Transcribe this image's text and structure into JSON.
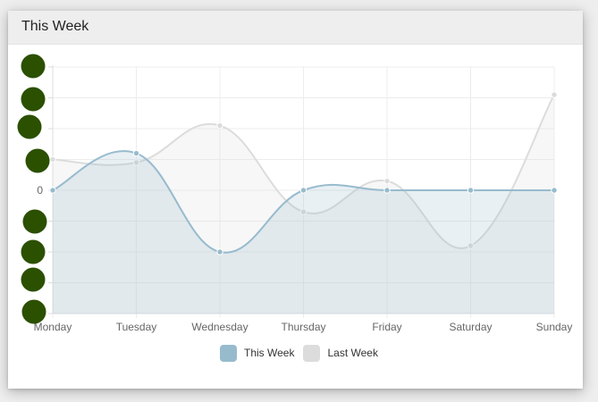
{
  "card": {
    "title": "This Week"
  },
  "legend": {
    "items": [
      {
        "label": "This Week",
        "color": "#97bbcd"
      },
      {
        "label": "Last Week",
        "color": "#dcdcdc"
      }
    ]
  },
  "chart_data": {
    "type": "line",
    "categories": [
      "Monday",
      "Tuesday",
      "Wednesday",
      "Thursday",
      "Friday",
      "Saturday",
      "Sunday"
    ],
    "y_tick_labels": [
      "0"
    ],
    "ylim": [
      -4,
      4
    ],
    "grid": true,
    "legend_position": "bottom",
    "series": [
      {
        "name": "This Week",
        "values": [
          0,
          1.2,
          -2,
          0,
          0,
          0,
          0
        ],
        "stroke": "#97bbcd",
        "fill": "rgba(151,187,205,0.22)"
      },
      {
        "name": "Last Week",
        "values": [
          1,
          0.9,
          2.1,
          -0.7,
          0.3,
          -1.8,
          3.1
        ],
        "stroke": "#dcdcdc",
        "fill": "rgba(220,220,220,0.22)"
      }
    ]
  },
  "overlay": {
    "marker_color": "#2b5000"
  }
}
